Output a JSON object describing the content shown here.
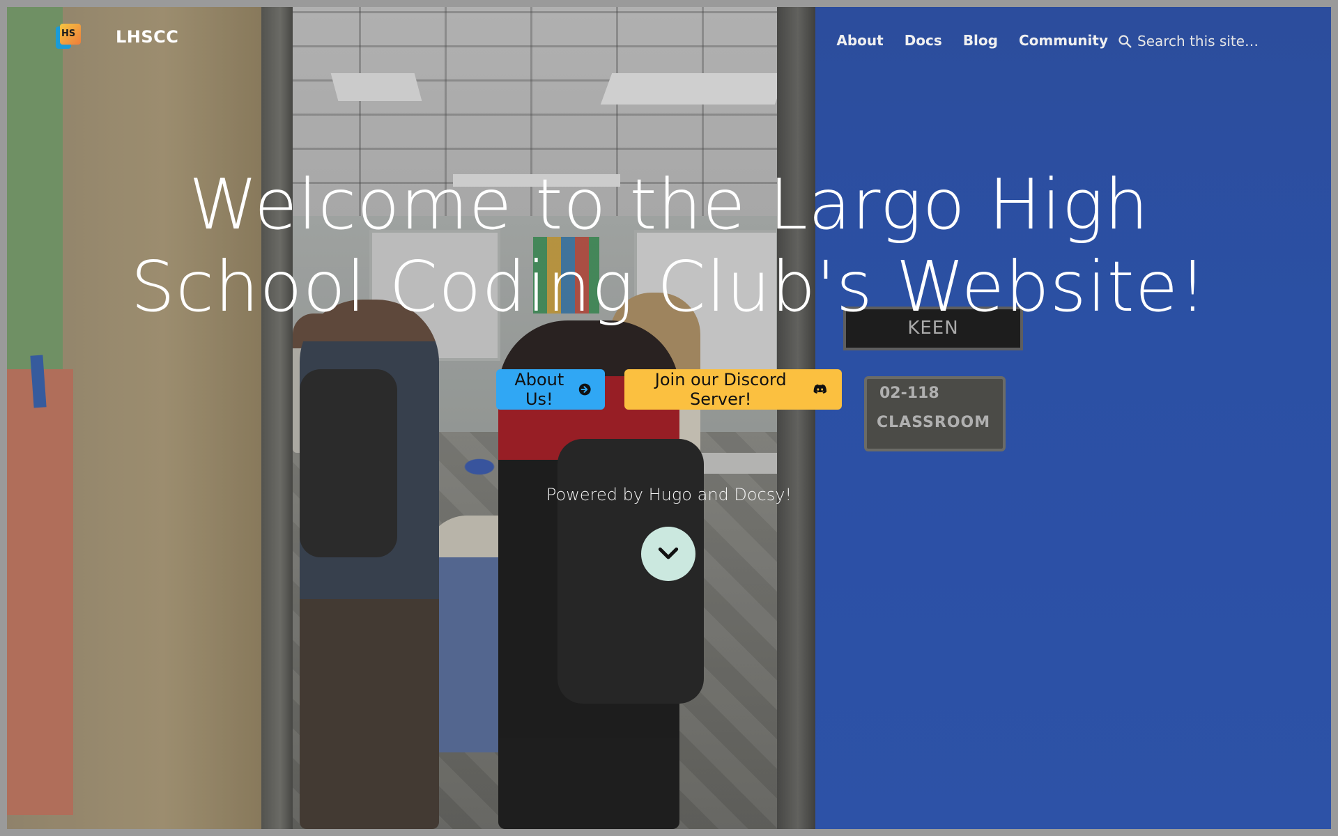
{
  "navbar": {
    "logo_text": "HS",
    "brand": "LHSCC",
    "links": [
      "About",
      "Docs",
      "Blog",
      "Community"
    ],
    "search_placeholder": "Search this site…"
  },
  "scene": {
    "door_name_plate": "KEEN",
    "room_number": "02-118",
    "room_label": "CLASSROOM"
  },
  "hero": {
    "title": "Welcome to the Largo High School Coding Club's Website!",
    "primary_button": "About Us!",
    "secondary_button": "Join our Discord Server!",
    "powered_by": "Powered by Hugo and Docsy!"
  },
  "icons": {
    "primary_button_icon": "arrow-circle-right-icon",
    "secondary_button_icon": "discord-icon",
    "scroll_icon": "chevron-down-icon",
    "search_icon": "search-icon"
  },
  "colors": {
    "primary_button": "#30a7f4",
    "secondary_button": "#fbc040",
    "scroll_button": "#cbe8df",
    "door_blue": "#2d59c0"
  }
}
